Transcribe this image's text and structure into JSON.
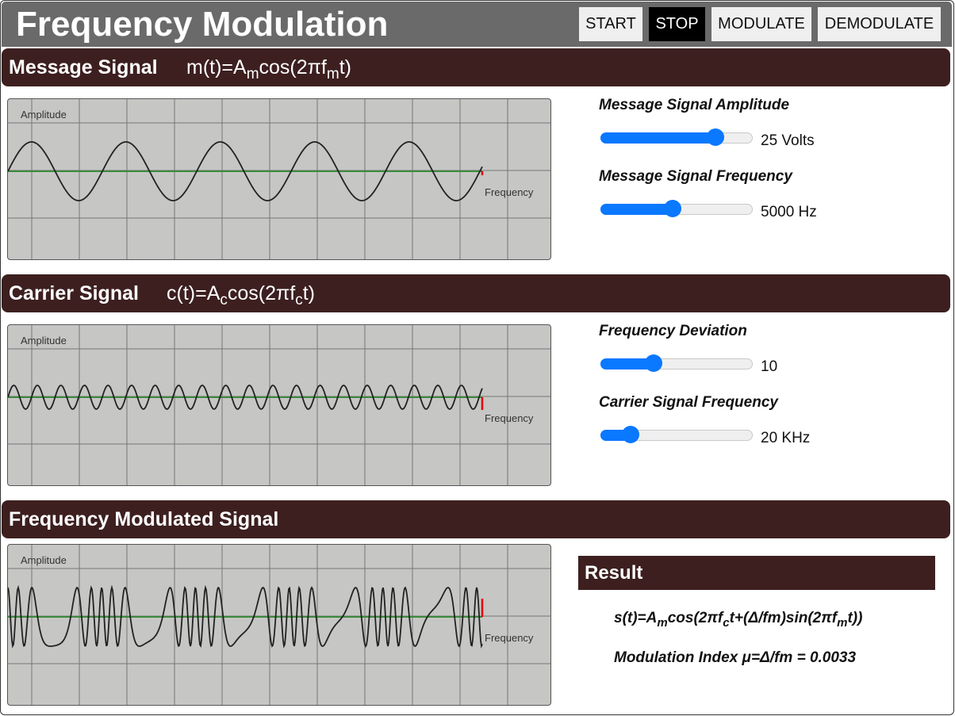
{
  "header": {
    "title": "Frequency Modulation",
    "buttons": {
      "start": "START",
      "stop": "STOP",
      "modulate": "MODULATE",
      "demodulate": "DEMODULATE"
    },
    "active_button": "stop"
  },
  "message_section": {
    "title": "Message Signal",
    "formula": {
      "lhs": "m(t)=A",
      "sub1": "m",
      "mid": "cos(2πf",
      "sub2": "m",
      "rhs": "t)"
    }
  },
  "carrier_section": {
    "title": "Carrier Signal",
    "formula": {
      "lhs": "c(t)=A",
      "sub1": "c",
      "mid": "cos(2πf",
      "sub2": "c",
      "rhs": "t)"
    }
  },
  "fm_section": {
    "title": "Frequency Modulated Signal"
  },
  "scope_labels": {
    "amplitude": "Amplitude",
    "frequency": "Frequency"
  },
  "controls": {
    "message_amplitude": {
      "label": "Message Signal Amplitude",
      "value": "25 Volts",
      "fraction": 0.79
    },
    "message_frequency": {
      "label": "Message Signal Frequency",
      "value": "5000 Hz",
      "fraction": 0.47
    },
    "frequency_deviation": {
      "label": "Frequency Deviation",
      "value": "10",
      "fraction": 0.33
    },
    "carrier_frequency": {
      "label": "Carrier Signal Frequency",
      "value": "20 KHz",
      "fraction": 0.16
    }
  },
  "result": {
    "title": "Result",
    "equation": {
      "p1": "s(t)=A",
      "s1": "m",
      "p2": "cos(2πf",
      "s2": "c",
      "p3": "t+(Δ/fm)sin(2πf",
      "s3": "m",
      "p4": "t))"
    },
    "modulation_index": "Modulation Index  μ=Δ/fm = 0.0033"
  },
  "colors": {
    "header_bg": "#6a6a6a",
    "section_bg": "#3d1f1f",
    "scope_bg": "#c6c6c4",
    "grid": "#777777",
    "baseline": "#3a8a3a",
    "waveform": "#222222",
    "cursor": "#e00000",
    "slider_accent": "#0a78ff"
  }
}
